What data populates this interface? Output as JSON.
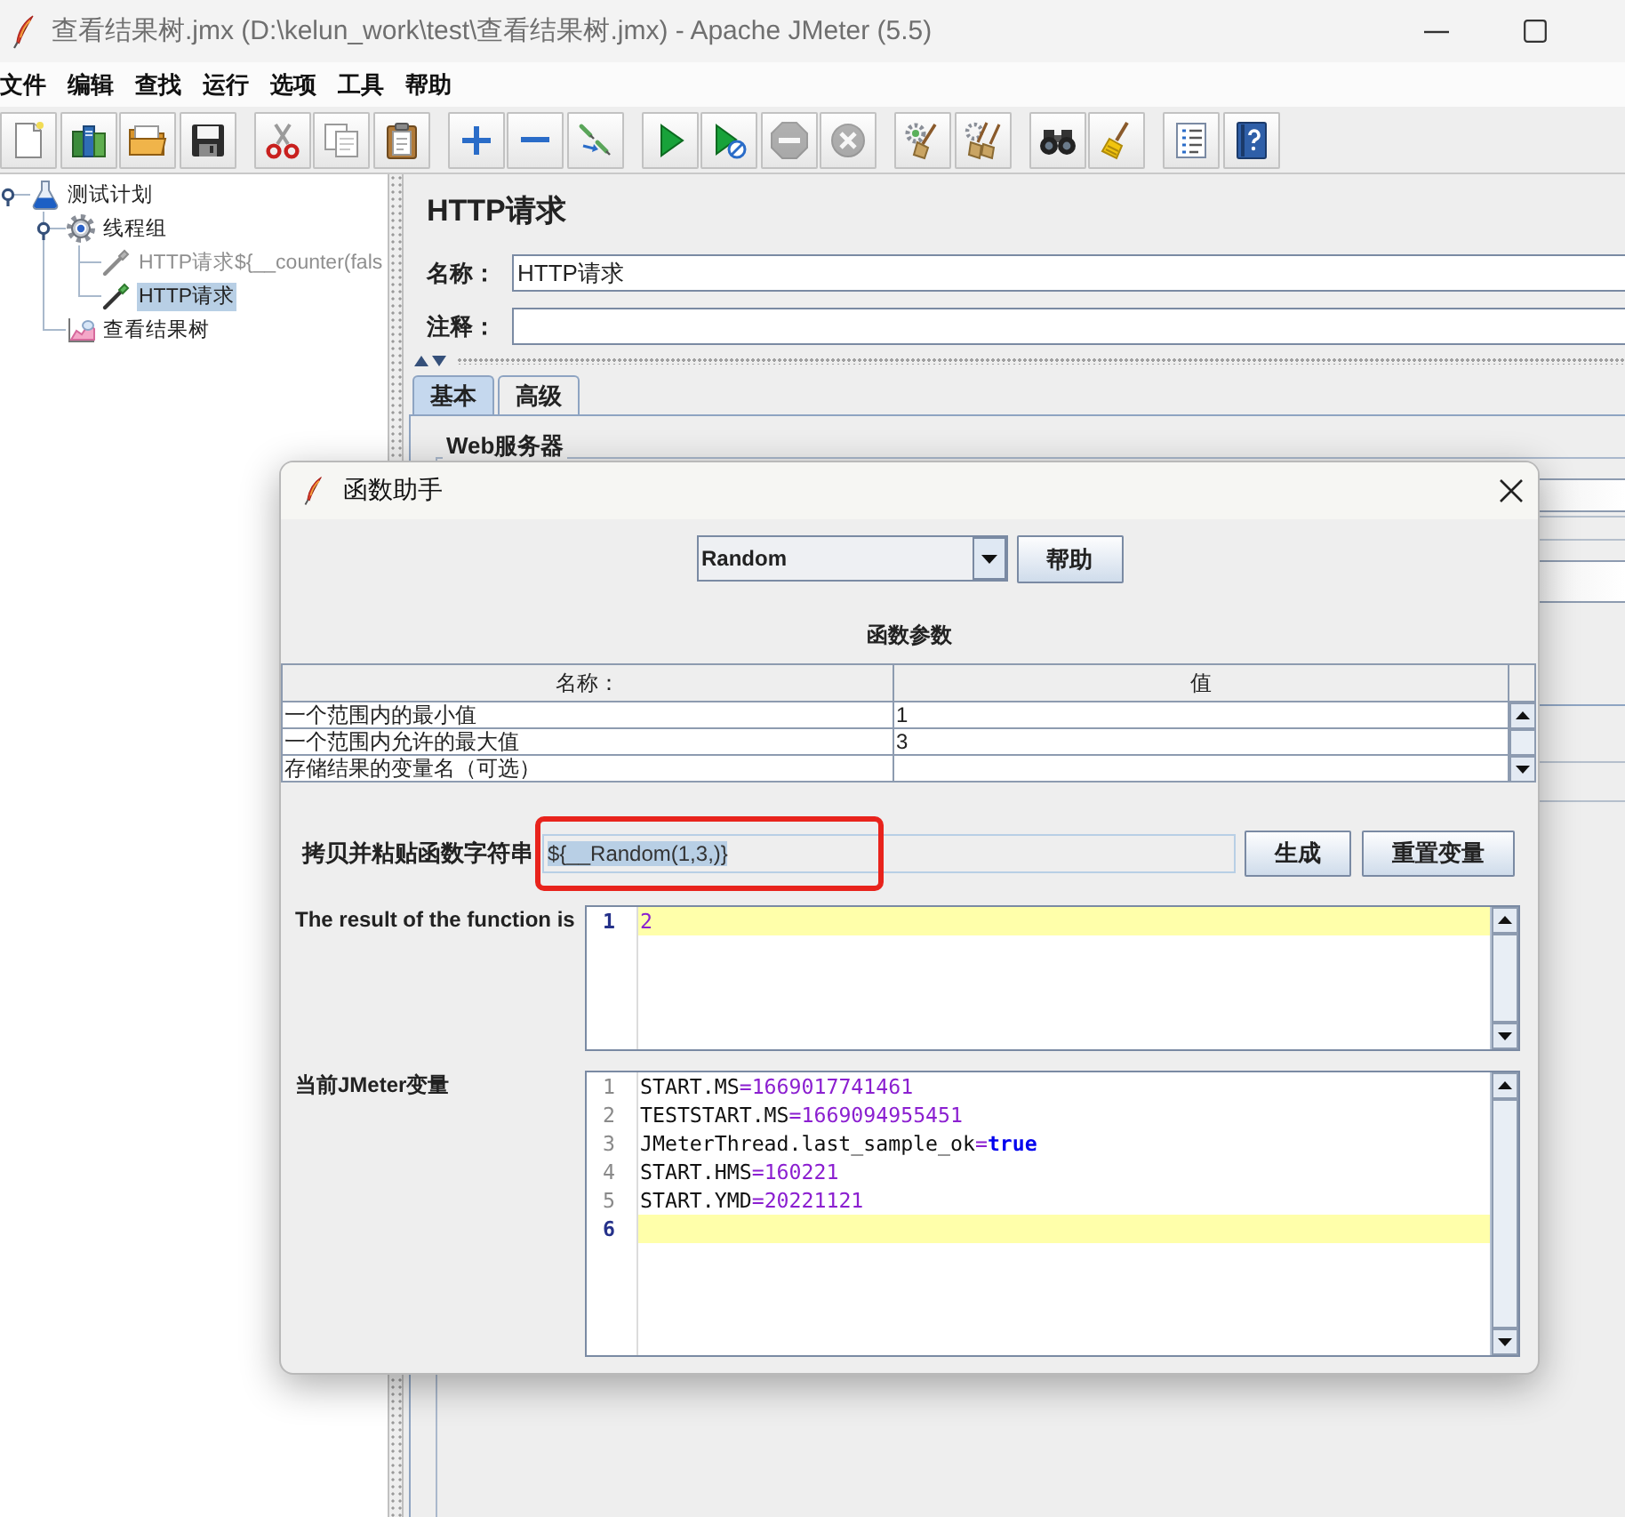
{
  "window": {
    "title": "查看结果树.jmx (D:\\kelun_work\\test\\查看结果树.jmx) - Apache JMeter (5.5)"
  },
  "menu": [
    "文件",
    "编辑",
    "查找",
    "运行",
    "选项",
    "工具",
    "帮助"
  ],
  "toolbar": {
    "groups": [
      {
        "buttons": [
          {
            "kind": "new",
            "disabled": false
          },
          {
            "kind": "templates",
            "disabled": false
          },
          {
            "kind": "open",
            "disabled": false
          },
          {
            "kind": "save",
            "disabled": false
          }
        ]
      },
      {
        "buttons": [
          {
            "kind": "cut",
            "disabled": false
          },
          {
            "kind": "copy",
            "disabled": false
          },
          {
            "kind": "paste",
            "disabled": false
          }
        ]
      },
      {
        "buttons": [
          {
            "kind": "expand",
            "disabled": false
          },
          {
            "kind": "collapse",
            "disabled": false
          },
          {
            "kind": "toggle",
            "disabled": false
          }
        ]
      },
      {
        "buttons": [
          {
            "kind": "start",
            "disabled": false
          },
          {
            "kind": "start_no_pauses",
            "disabled": false
          },
          {
            "kind": "stop",
            "disabled": true
          },
          {
            "kind": "shutdown",
            "disabled": true
          }
        ]
      },
      {
        "buttons": [
          {
            "kind": "clear",
            "disabled": false
          },
          {
            "kind": "clear_all",
            "disabled": false
          }
        ]
      },
      {
        "buttons": [
          {
            "kind": "search",
            "disabled": false
          },
          {
            "kind": "reset_search",
            "disabled": false
          }
        ]
      },
      {
        "buttons": [
          {
            "kind": "function_helper",
            "disabled": false
          },
          {
            "kind": "help",
            "disabled": false
          }
        ]
      }
    ]
  },
  "tree": {
    "items": [
      {
        "label": "测试计划",
        "kind": "test_plan",
        "expanded": true,
        "selected": false,
        "disabled": false,
        "children": [
          {
            "label": "线程组",
            "kind": "thread_group",
            "expanded": true,
            "selected": false,
            "disabled": false,
            "children": [
              {
                "label": "HTTP请求${__counter(fals",
                "kind": "sampler",
                "selected": false,
                "disabled": true
              },
              {
                "label": "HTTP请求",
                "kind": "sampler",
                "selected": true,
                "disabled": false
              }
            ]
          },
          {
            "label": "查看结果树",
            "kind": "listener",
            "selected": false,
            "disabled": false
          }
        ]
      }
    ]
  },
  "editor": {
    "title": "HTTP请求",
    "fields": [
      {
        "label": "名称：",
        "value": "HTTP请求"
      },
      {
        "label": "注释："
      }
    ],
    "tabs": [
      {
        "label": "基本",
        "selected": true
      },
      {
        "label": "高级",
        "selected": false
      }
    ],
    "section": {
      "title": "Web服务器"
    }
  },
  "dialog": {
    "title": "函数助手",
    "function": {
      "value": "Random"
    },
    "help_button": "帮助",
    "parameters": {
      "title": "函数参数",
      "columns": [
        "名称：",
        "值"
      ],
      "rows": [
        {
          "name": "一个范围内的最小值",
          "value": "1"
        },
        {
          "name": "一个范围内允许的最大值",
          "value": "3"
        },
        {
          "name": "存储结果的变量名（可选）"
        }
      ]
    },
    "function_string": {
      "label": "拷贝并粘贴函数字符串",
      "value": "${__Random(1,3,)}",
      "text_selected": true,
      "annotated": true
    },
    "buttons": [
      "生成",
      "重置变量"
    ],
    "result": {
      "label": "The result of the function is",
      "lines": [
        {
          "number": "1",
          "current": true,
          "tokens": [
            {
              "text": "2",
              "kind": "number"
            }
          ]
        }
      ]
    },
    "variables": {
      "label": "当前JMeter变量",
      "lines": [
        {
          "number": "1",
          "current": false,
          "tokens": [
            {
              "text": "START.MS",
              "kind": "identifier"
            },
            {
              "text": "=",
              "kind": "operator"
            },
            {
              "text": "1669017741461",
              "kind": "number"
            }
          ]
        },
        {
          "number": "2",
          "current": false,
          "tokens": [
            {
              "text": "TESTSTART.MS",
              "kind": "identifier"
            },
            {
              "text": "=",
              "kind": "operator"
            },
            {
              "text": "1669094955451",
              "kind": "number"
            }
          ]
        },
        {
          "number": "3",
          "current": false,
          "tokens": [
            {
              "text": "JMeterThread.last_sample_ok",
              "kind": "identifier"
            },
            {
              "text": "=",
              "kind": "operator"
            },
            {
              "text": "true",
              "kind": "keyword"
            }
          ]
        },
        {
          "number": "4",
          "current": false,
          "tokens": [
            {
              "text": "START.HMS",
              "kind": "identifier"
            },
            {
              "text": "=",
              "kind": "operator"
            },
            {
              "text": "160221",
              "kind": "number"
            }
          ]
        },
        {
          "number": "5",
          "current": false,
          "tokens": [
            {
              "text": "START.YMD",
              "kind": "identifier"
            },
            {
              "text": "=",
              "kind": "operator"
            },
            {
              "text": "20221121",
              "kind": "number"
            }
          ]
        },
        {
          "number": "6",
          "current": true
        }
      ]
    }
  }
}
